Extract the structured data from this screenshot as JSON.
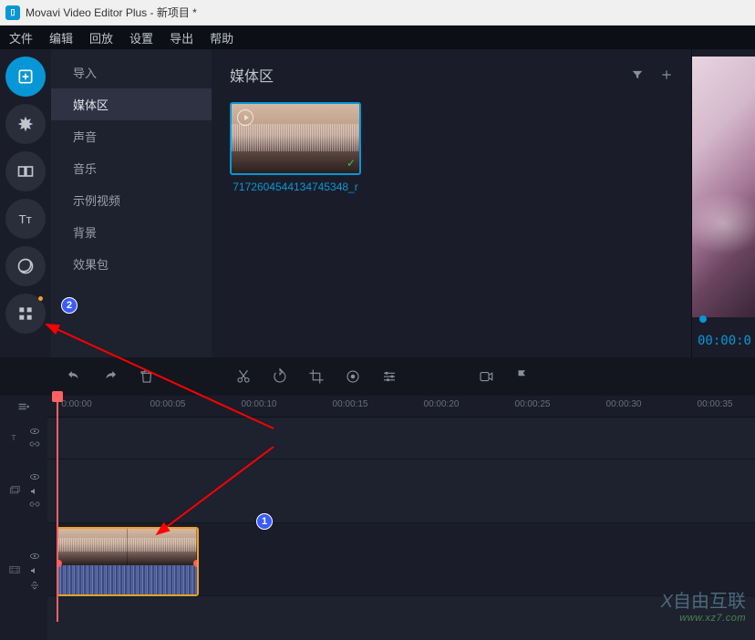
{
  "titlebar": {
    "app_icon_text": "▯",
    "title": "Movavi Video Editor Plus - 新项目 *"
  },
  "menu": {
    "items": [
      "文件",
      "编辑",
      "回放",
      "设置",
      "导出",
      "帮助"
    ]
  },
  "sidebar": {
    "items": [
      {
        "label": "导入"
      },
      {
        "label": "媒体区",
        "selected": true
      },
      {
        "label": "声音"
      },
      {
        "label": "音乐"
      },
      {
        "label": "示例视频"
      },
      {
        "label": "背景"
      },
      {
        "label": "效果包"
      }
    ]
  },
  "media": {
    "title": "媒体区",
    "thumb": {
      "name": "7172604544134745348_r"
    }
  },
  "preview": {
    "time": "00:00:0"
  },
  "timeline": {
    "ticks": [
      "0:00:00",
      "00:00:05",
      "00:00:10",
      "00:00:15",
      "00:00:20",
      "00:00:25",
      "00:00:30",
      "00:00:35"
    ]
  },
  "annotations": {
    "num1": "1",
    "num2": "2"
  },
  "watermark": {
    "brand": "自由互联",
    "url": "www.xz7.com"
  }
}
